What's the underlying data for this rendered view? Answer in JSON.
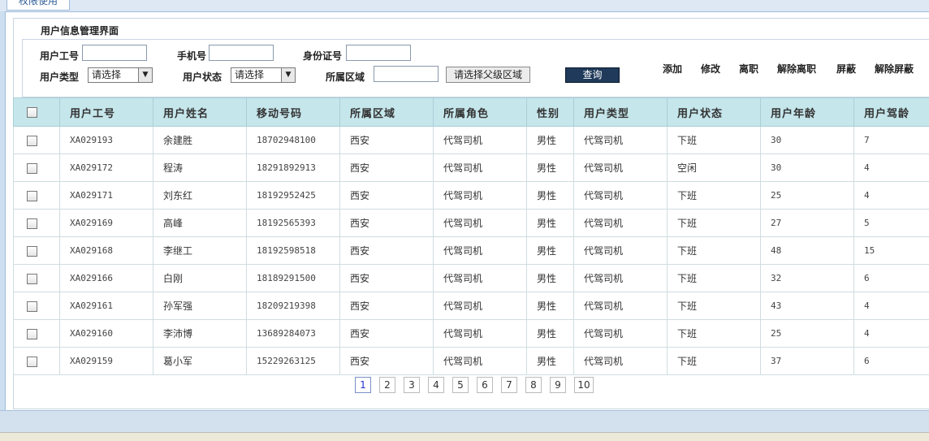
{
  "tab_label": "权限使用",
  "page_title": "用户信息管理界面",
  "filters": {
    "emp_no_label": "用户工号",
    "phone_label": "手机号",
    "id_card_label": "身份证号",
    "user_type_label": "用户类型",
    "user_type_value": "请选择",
    "user_status_label": "用户状态",
    "user_status_value": "请选择",
    "region_label": "所属区域",
    "select_parent_label": "请选择父级区域",
    "query_label": "查询"
  },
  "actions": [
    "添加",
    "修改",
    "离职",
    "解除离职",
    "屏蔽",
    "解除屏蔽"
  ],
  "table": {
    "headers": [
      "用户工号",
      "用户姓名",
      "移动号码",
      "所属区域",
      "所属角色",
      "性别",
      "用户类型",
      "用户状态",
      "用户年龄",
      "用户驾龄"
    ],
    "rows": [
      [
        "XA029193",
        "余建胜",
        "18702948100",
        "西安",
        "代驾司机",
        "男性",
        "代驾司机",
        "下班",
        "30",
        "7"
      ],
      [
        "XA029172",
        "程涛",
        "18291892913",
        "西安",
        "代驾司机",
        "男性",
        "代驾司机",
        "空闲",
        "30",
        "4"
      ],
      [
        "XA029171",
        "刘东红",
        "18192952425",
        "西安",
        "代驾司机",
        "男性",
        "代驾司机",
        "下班",
        "25",
        "4"
      ],
      [
        "XA029169",
        "高峰",
        "18192565393",
        "西安",
        "代驾司机",
        "男性",
        "代驾司机",
        "下班",
        "27",
        "5"
      ],
      [
        "XA029168",
        "李继工",
        "18192598518",
        "西安",
        "代驾司机",
        "男性",
        "代驾司机",
        "下班",
        "48",
        "15"
      ],
      [
        "XA029166",
        "白刚",
        "18189291500",
        "西安",
        "代驾司机",
        "男性",
        "代驾司机",
        "下班",
        "32",
        "6"
      ],
      [
        "XA029161",
        "孙军强",
        "18209219398",
        "西安",
        "代驾司机",
        "男性",
        "代驾司机",
        "下班",
        "43",
        "4"
      ],
      [
        "XA029160",
        "李沛博",
        "13689284073",
        "西安",
        "代驾司机",
        "男性",
        "代驾司机",
        "下班",
        "25",
        "4"
      ],
      [
        "XA029159",
        "葛小军",
        "15229263125",
        "西安",
        "代驾司机",
        "男性",
        "代驾司机",
        "下班",
        "37",
        "6"
      ]
    ]
  },
  "pagination": {
    "pages": [
      "1",
      "2",
      "3",
      "4",
      "5",
      "6",
      "7",
      "8",
      "9",
      "10"
    ],
    "current": "1"
  }
}
